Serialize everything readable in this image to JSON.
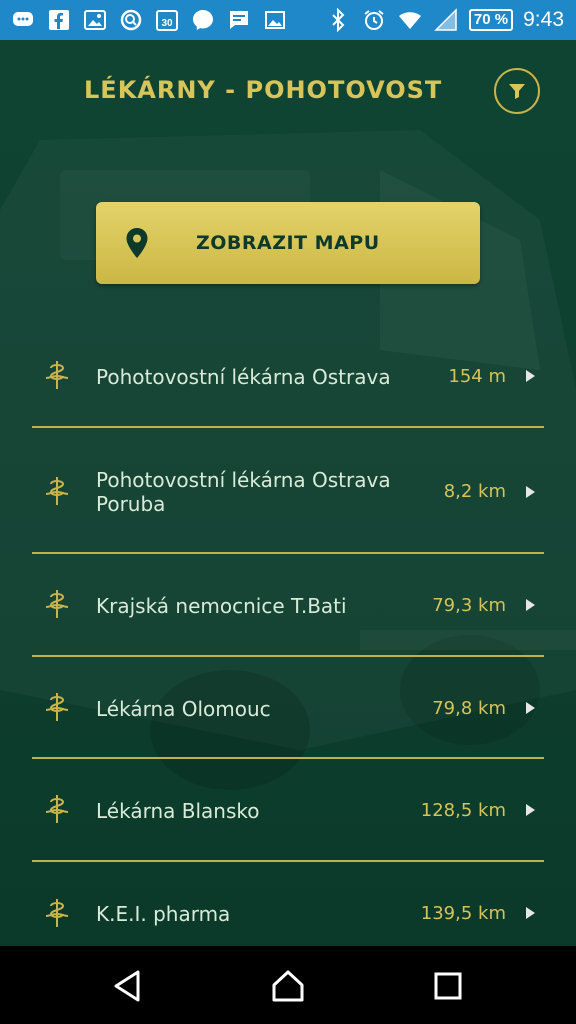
{
  "status_bar": {
    "battery": "70 %",
    "time": "9:43",
    "left_icons": [
      "chat-bubble-icon",
      "facebook-icon",
      "photos-icon",
      "search-icon",
      "calendar-icon",
      "messenger-icon",
      "message-icon",
      "image-icon"
    ],
    "right_icons": [
      "bluetooth-icon",
      "alarm-icon",
      "wifi-icon",
      "signal-icon",
      "battery-icon"
    ]
  },
  "header": {
    "title": "LÉKÁRNY - POHOTOVOST",
    "filter_icon": "filter-icon"
  },
  "map_button": {
    "label": "ZOBRAZIT MAPU",
    "icon": "map-pin-icon"
  },
  "pharmacies": [
    {
      "name": "Pohotovostní lékárna Ostrava",
      "distance": "154 m"
    },
    {
      "name": "Pohotovostní lékárna Ostrava Poruba",
      "distance": "8,2 km"
    },
    {
      "name": "Krajská nemocnice T.Bati",
      "distance": "79,3 km"
    },
    {
      "name": "Lékárna Olomouc",
      "distance": "79,8 km"
    },
    {
      "name": "Lékárna Blansko",
      "distance": "128,5 km"
    },
    {
      "name": "K.E.I. pharma",
      "distance": "139,5 km"
    }
  ],
  "colors": {
    "accent_gold": "#d8c55a",
    "background_green": "#0f4432",
    "status_bar_blue": "#1e88c8"
  },
  "nav_bar": {
    "back_icon": "back-triangle-icon",
    "home_icon": "home-icon",
    "recents_icon": "recents-square-icon"
  }
}
